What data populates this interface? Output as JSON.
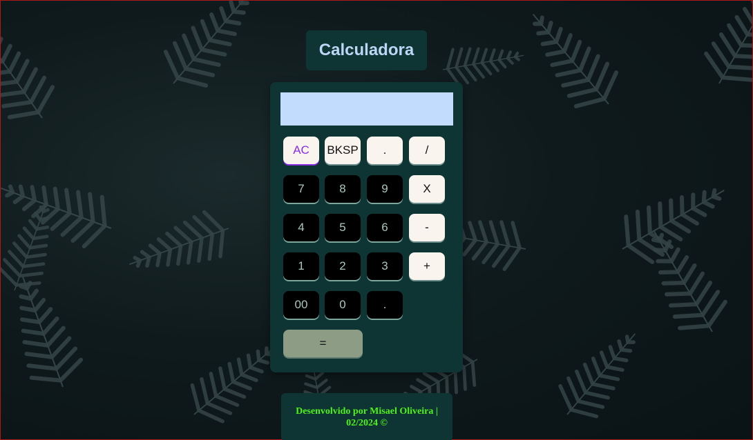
{
  "page": {
    "title": "Calculadora"
  },
  "display": {
    "value": ""
  },
  "keys": {
    "ac": "AC",
    "bksp": "BKSP",
    "dot_top": ".",
    "divide": "/",
    "seven": "7",
    "eight": "8",
    "nine": "9",
    "multiply": "X",
    "four": "4",
    "five": "5",
    "six": "6",
    "minus": "-",
    "one": "1",
    "two": "2",
    "three": "3",
    "plus": "+",
    "double_zero": "00",
    "zero": "0",
    "dot_bottom": ".",
    "equals": "="
  },
  "footer": {
    "line1": "Desenvolvido por Misael Oliveira |",
    "line2": "02/2024 ©"
  },
  "colors": {
    "panel": "#0f3434",
    "display": "#c2dcfe",
    "title_text": "#bcd7f5",
    "footer_text": "#4ff21a",
    "operator_key": "#f9f4ee",
    "number_key": "#000000",
    "equals_key": "#8d9c84",
    "ac_text": "#8a2be2"
  }
}
